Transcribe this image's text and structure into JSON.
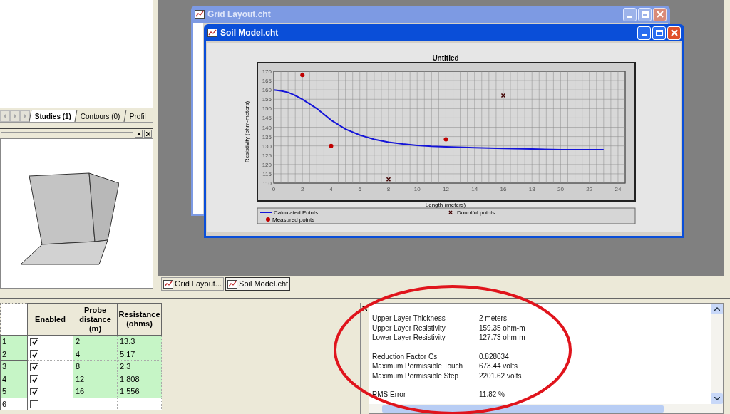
{
  "left_panel": {
    "tabs": [
      {
        "label": "Studies (1)",
        "selected": true
      },
      {
        "label": "Contours (0)",
        "selected": false
      },
      {
        "label": "Profil",
        "selected": false
      }
    ]
  },
  "windows": [
    {
      "title": "Grid Layout.cht",
      "active": false
    },
    {
      "title": "Soil Model.cht",
      "active": true,
      "chart_data": {
        "type": "line",
        "title": "Untitled",
        "grid": true,
        "legend": "bottom",
        "xlabel": "Length (meters)",
        "ylabel": "Resistivity (ohm-meters)",
        "xlim": [
          0,
          24.5
        ],
        "ylim": [
          110,
          170
        ],
        "xticks": [
          0,
          2,
          4,
          6,
          8,
          10,
          12,
          14,
          16,
          18,
          20,
          22,
          24
        ],
        "yticks": [
          110,
          115,
          120,
          125,
          130,
          135,
          140,
          145,
          150,
          155,
          160,
          165,
          170
        ],
        "series": [
          {
            "name": "Calculated Points",
            "type": "line",
            "color": "#1414d8",
            "x": [
              0,
              0.5,
              1,
              1.5,
              2,
              3,
              4,
              5,
              6,
              7,
              8,
              9,
              10,
              11,
              12,
              14,
              16,
              18,
              20,
              23
            ],
            "values": [
              160,
              159.5,
              158.7,
              157,
              155,
              150,
              143.8,
              139,
              135.8,
              133.5,
              132,
              131,
              130.3,
              129.8,
              129.5,
              129,
              128.6,
              128.3,
              128,
              128
            ]
          },
          {
            "name": "Measured points",
            "type": "scatter",
            "color": "#c00000",
            "x": [
              2,
              4,
              12
            ],
            "values": [
              168,
              130,
              133.5
            ]
          },
          {
            "name": "Doubtful points",
            "type": "scatter",
            "color": "#400000",
            "x": [
              8,
              16
            ],
            "values": [
              112,
              157
            ]
          }
        ]
      }
    }
  ],
  "mdi_tabs": [
    {
      "label": "Grid Layout...",
      "selected": false
    },
    {
      "label": "Soil Model.cht",
      "selected": true
    }
  ],
  "table": {
    "columns": [
      "Enabled",
      "Probe distance (m)",
      "Resistance (ohms)"
    ],
    "rows": [
      {
        "index": "1",
        "enabled": true,
        "distance": "2",
        "resistance": "13.3"
      },
      {
        "index": "2",
        "enabled": true,
        "distance": "4",
        "resistance": "5.17"
      },
      {
        "index": "3",
        "enabled": true,
        "distance": "8",
        "resistance": "2.3"
      },
      {
        "index": "4",
        "enabled": true,
        "distance": "12",
        "resistance": "1.808"
      },
      {
        "index": "5",
        "enabled": true,
        "distance": "16",
        "resistance": "1.556"
      },
      {
        "index": "6",
        "enabled": false
      }
    ]
  },
  "results": [
    [
      {
        "label": "Upper Layer Thickness",
        "value": "2 meters"
      },
      {
        "label": "Upper Layer Resistivity",
        "value": "159.35 ohm-m"
      },
      {
        "label": "Lower Layer Resistivity",
        "value": "127.73 ohm-m"
      }
    ],
    [
      {
        "label": "Reduction Factor Cs",
        "value": "0.828034"
      },
      {
        "label": "Maximum Permissible Touch",
        "value": "673.44 volts"
      },
      {
        "label": "Maximum Permissible Step",
        "value": "2201.62 volts"
      }
    ],
    [
      {
        "label": "RMS Error",
        "value": "11.82 %"
      }
    ]
  ]
}
